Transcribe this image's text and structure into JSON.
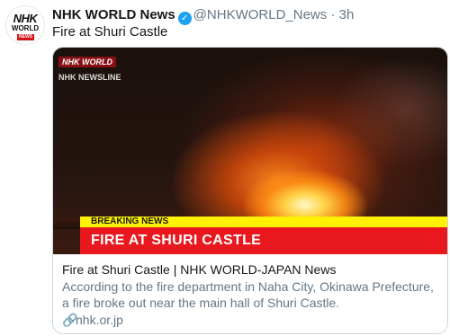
{
  "account": {
    "avatar_text_top": "NHK",
    "avatar_text_mid": "WORLD",
    "avatar_text_bottom": "NEWS",
    "name": "NHK WORLD News",
    "handle": "@NHKWORLD_News",
    "separator": "·",
    "time": "3h",
    "verified_icon": "verified-badge-icon"
  },
  "tweet": {
    "text": "Fire at Shuri Castle"
  },
  "media": {
    "logo": "NHK WORLD",
    "newsline": "NHK NEWSLINE",
    "banner_label": "BREAKING NEWS",
    "banner_title": "FIRE AT SHURI CASTLE"
  },
  "card": {
    "title": "Fire at Shuri Castle | NHK WORLD-JAPAN News",
    "description": "According to the fire department in Naha City, Okinawa Prefecture, a fire broke out near the main hall of Shuri Castle.",
    "domain": "nhk.or.jp",
    "link_icon": "link-icon"
  },
  "colors": {
    "verified": "#1da1f2",
    "banner_red": "#e8181e",
    "banner_yellow": "#fff100",
    "muted_text": "#657786"
  }
}
